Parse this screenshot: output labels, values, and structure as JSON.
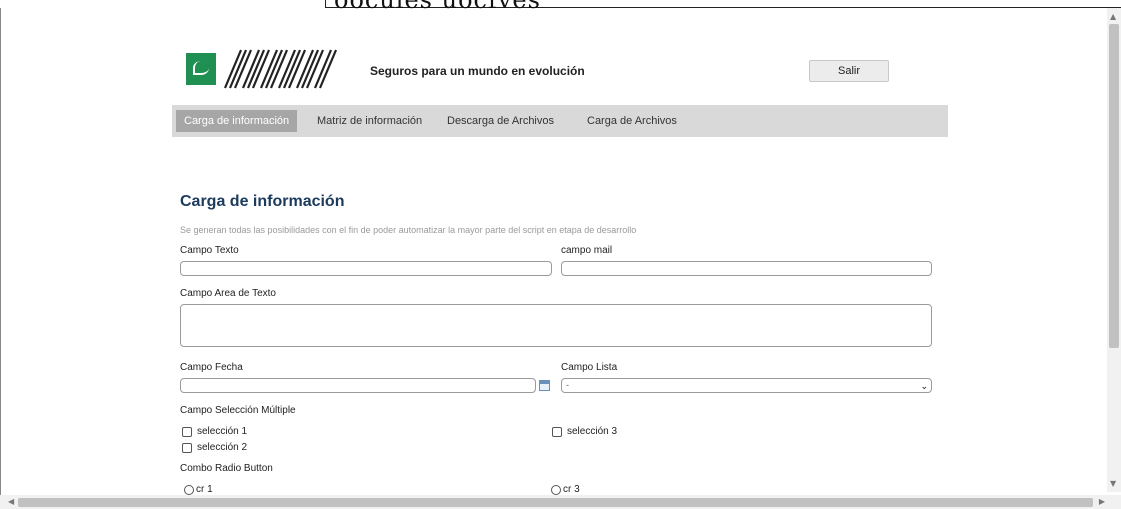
{
  "top_caption": "oocules uocfves",
  "header": {
    "tagline": "Seguros para un mundo en evolución",
    "logout_label": "Salir"
  },
  "nav": {
    "items": [
      {
        "label": "Carga de información",
        "active": true
      },
      {
        "label": "Matriz de información",
        "active": false
      },
      {
        "label": "Descarga de Archivos",
        "active": false
      },
      {
        "label": "Carga de Archivos",
        "active": false
      }
    ]
  },
  "main": {
    "title": "Carga de información",
    "subtitle": "Se generan todas las posibilidades con el fin de poder automatizar la mayor parte del script en etapa de desarrollo",
    "campo_texto": {
      "label": "Campo Texto",
      "value": ""
    },
    "campo_mail": {
      "label": "campo mail",
      "value": ""
    },
    "campo_area": {
      "label": "Campo Area de Texto",
      "value": ""
    },
    "campo_fecha": {
      "label": "Campo Fecha",
      "value": ""
    },
    "campo_lista": {
      "label": "Campo Lista",
      "selected": "-"
    },
    "multi": {
      "label": "Campo Selección Múltiple",
      "options": [
        "selección 1",
        "selección 2",
        "selección 3"
      ]
    },
    "radio": {
      "label": "Combo Radio Button",
      "options": [
        "cr 1",
        "cr 3"
      ]
    }
  },
  "colors": {
    "title": "#1b3a5c",
    "nav_bg": "#d9d9d9",
    "nav_active": "#a6a6a6",
    "logo_green": "#1f8f52"
  }
}
